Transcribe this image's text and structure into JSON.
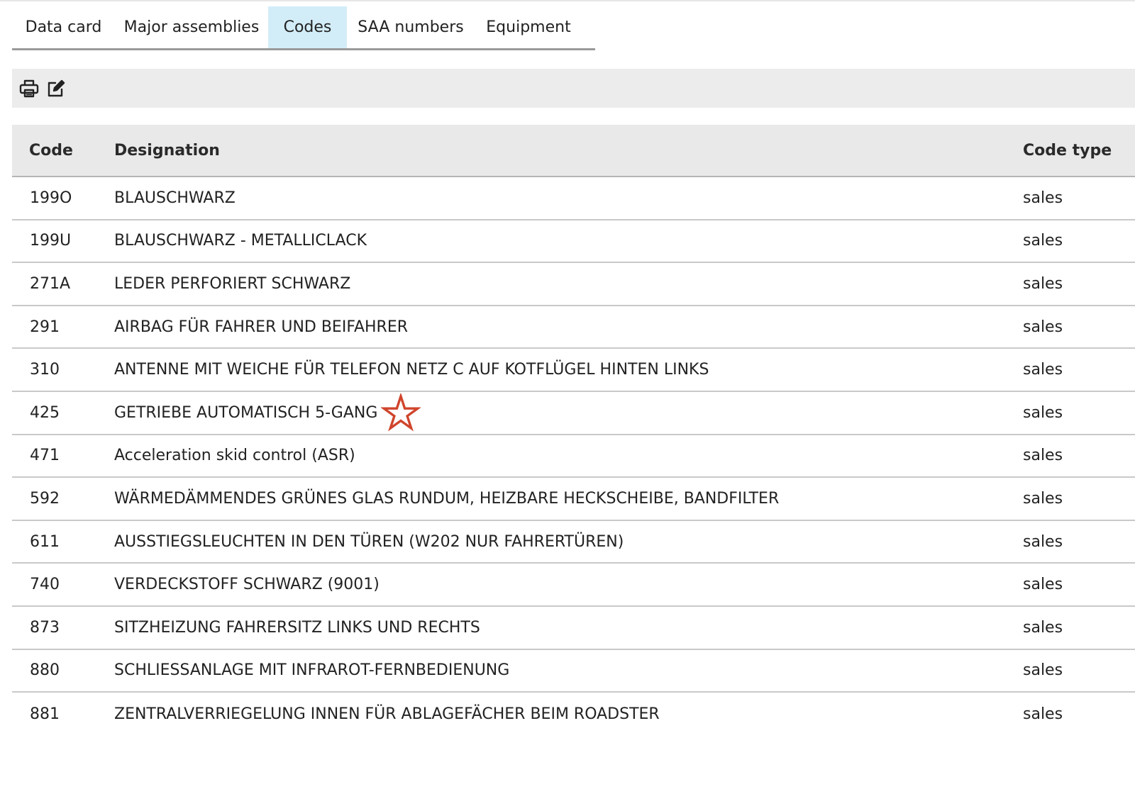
{
  "tabs": [
    {
      "label": "Data card",
      "active": false
    },
    {
      "label": "Major assemblies",
      "active": false
    },
    {
      "label": "Codes",
      "active": true
    },
    {
      "label": "SAA numbers",
      "active": false
    },
    {
      "label": "Equipment",
      "active": false
    }
  ],
  "toolbar": {
    "print_icon": "printer-icon",
    "edit_icon": "edit-icon"
  },
  "table": {
    "headers": {
      "code": "Code",
      "designation": "Designation",
      "code_type": "Code type"
    },
    "rows": [
      {
        "code": "199O",
        "designation": "BLAUSCHWARZ",
        "code_type": "sales"
      },
      {
        "code": "199U",
        "designation": "BLAUSCHWARZ - METALLICLACK",
        "code_type": "sales"
      },
      {
        "code": "271A",
        "designation": "LEDER PERFORIERT SCHWARZ",
        "code_type": "sales"
      },
      {
        "code": "291",
        "designation": "AIRBAG FÜR FAHRER UND BEIFAHRER",
        "code_type": "sales"
      },
      {
        "code": "310",
        "designation": "ANTENNE MIT WEICHE FÜR TELEFON NETZ C AUF KOTFLÜGEL HINTEN LINKS",
        "code_type": "sales"
      },
      {
        "code": "425",
        "designation": "GETRIEBE AUTOMATISCH 5-GANG",
        "code_type": "sales",
        "starred": true
      },
      {
        "code": "471",
        "designation": "Acceleration skid control (ASR)",
        "code_type": "sales"
      },
      {
        "code": "592",
        "designation": "WÄRMEDÄMMENDES GRÜNES GLAS RUNDUM, HEIZBARE HECKSCHEIBE, BANDFILTER",
        "code_type": "sales"
      },
      {
        "code": "611",
        "designation": "AUSSTIEGSLEUCHTEN IN DEN TÜREN (W202 NUR FAHRERTÜREN)",
        "code_type": "sales"
      },
      {
        "code": "740",
        "designation": "VERDECKSTOFF SCHWARZ (9001)",
        "code_type": "sales"
      },
      {
        "code": "873",
        "designation": "SITZHEIZUNG FAHRERSITZ LINKS UND RECHTS",
        "code_type": "sales"
      },
      {
        "code": "880",
        "designation": "SCHLIESSANLAGE MIT INFRAROT-FERNBEDIENUNG",
        "code_type": "sales"
      },
      {
        "code": "881",
        "designation": "ZENTRALVERRIEGELUNG INNEN FÜR ABLAGEFÄCHER BEIM ROADSTER",
        "code_type": "sales"
      }
    ]
  },
  "colors": {
    "active_tab": "#d3edf8",
    "star": "#d0452c",
    "header_bg": "#e9e9e9",
    "toolbar_bg": "#ececec"
  }
}
